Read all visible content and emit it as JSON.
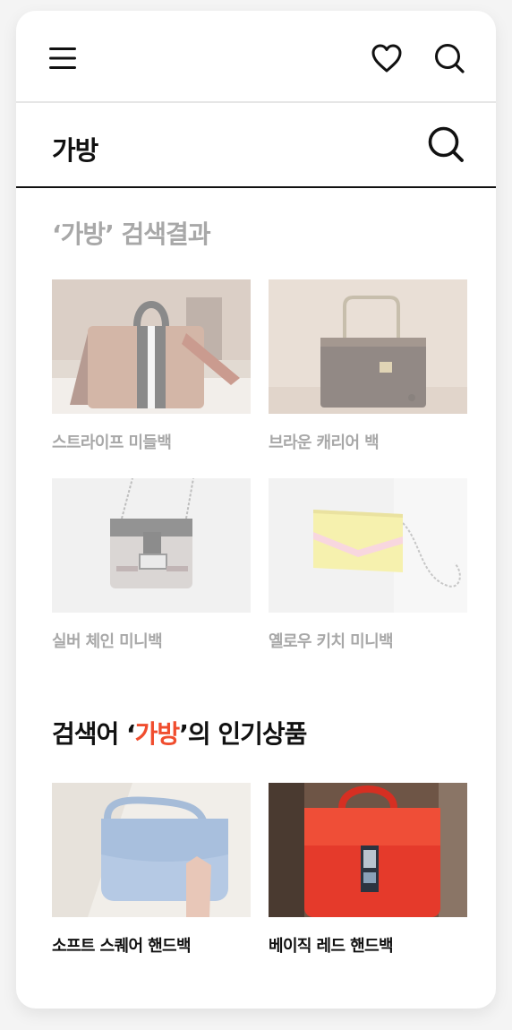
{
  "header": {
    "menu_icon": "menu-icon",
    "heart_icon": "heart-icon",
    "search_icon": "search-icon"
  },
  "search": {
    "query": "가방",
    "submit_icon": "search-icon"
  },
  "results": {
    "title": "‘가방’ 검색결과",
    "items": [
      {
        "label": "스트라이프 미들백"
      },
      {
        "label": "브라운 캐리어 백"
      },
      {
        "label": "실버 체인 미니백"
      },
      {
        "label": "옐로우 키치 미니백"
      }
    ]
  },
  "popular": {
    "title_prefix": "검색어 ‘",
    "title_keyword": "가방",
    "title_suffix": "’의 인기상품",
    "items": [
      {
        "label": "소프트 스퀘어 핸드백"
      },
      {
        "label": "베이직 레드 핸드백"
      }
    ]
  },
  "colors": {
    "accent": "#f04d2e",
    "faded_text": "#a8a8a8",
    "text": "#111111"
  }
}
